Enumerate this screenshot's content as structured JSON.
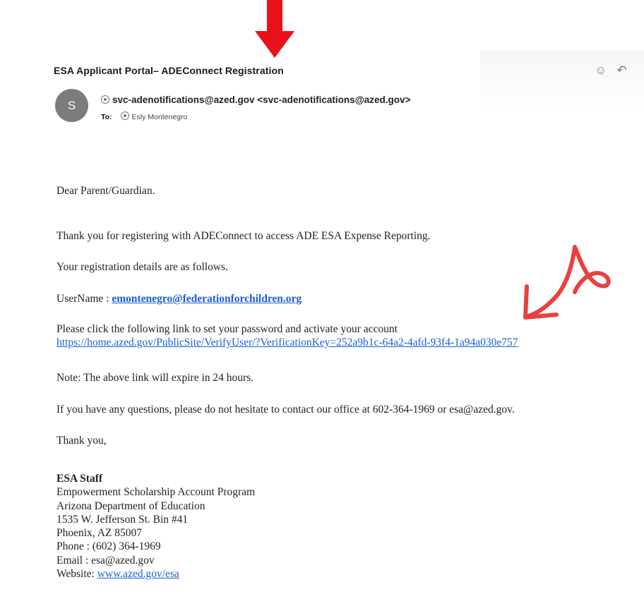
{
  "email": {
    "subject": "ESA Applicant Portal– ADEConnect Registration",
    "sender_initial": "S",
    "from": "svc-adenotifications@azed.gov <svc-adenotifications@azed.gov>",
    "to_label": "To:",
    "to": "Esly Montenegro"
  },
  "body": {
    "greeting": "Dear Parent/Guardian.",
    "thanks_line": "Thank you for registering with ADEConnect to access ADE ESA Expense Reporting.",
    "details_line": "Your registration details are as follows.",
    "username_label": "UserName : ",
    "username": "emontenegro@federationforchildren.org",
    "click_line": "Please click the following link to set your password and activate your account",
    "verify_link": "https://home.azed.gov/PublicSite/VerifyUser/?VerificationKey=252a9b1c-64a2-4afd-93f4-1a94a030e757",
    "note_line": "Note: The above link will expire in 24 hours.",
    "questions_line": "If you have any questions, please do not hesitate to contact our office at 602-364-1969 or esa@azed.gov.",
    "closing": "Thank you,"
  },
  "signature": {
    "name": "ESA Staff",
    "program": "Empowerment Scholarship Account Program",
    "department": "Arizona Department of Education",
    "address1": "1535 W. Jefferson St. Bin #41",
    "address2": "Phoenix, AZ 85007",
    "phone": "Phone : (602) 364-1969",
    "email": "Email : esa@azed.gov",
    "website_label": "Website: ",
    "website": "www.azed.gov/esa"
  },
  "header_icons": [
    "smiley-icon",
    "reply-icon"
  ],
  "colors": {
    "annotation_red": "#e8111b",
    "handdrawn_red": "#e8413f",
    "link_blue": "#1a5fd1",
    "avatar_gray": "#7c7c7c"
  }
}
